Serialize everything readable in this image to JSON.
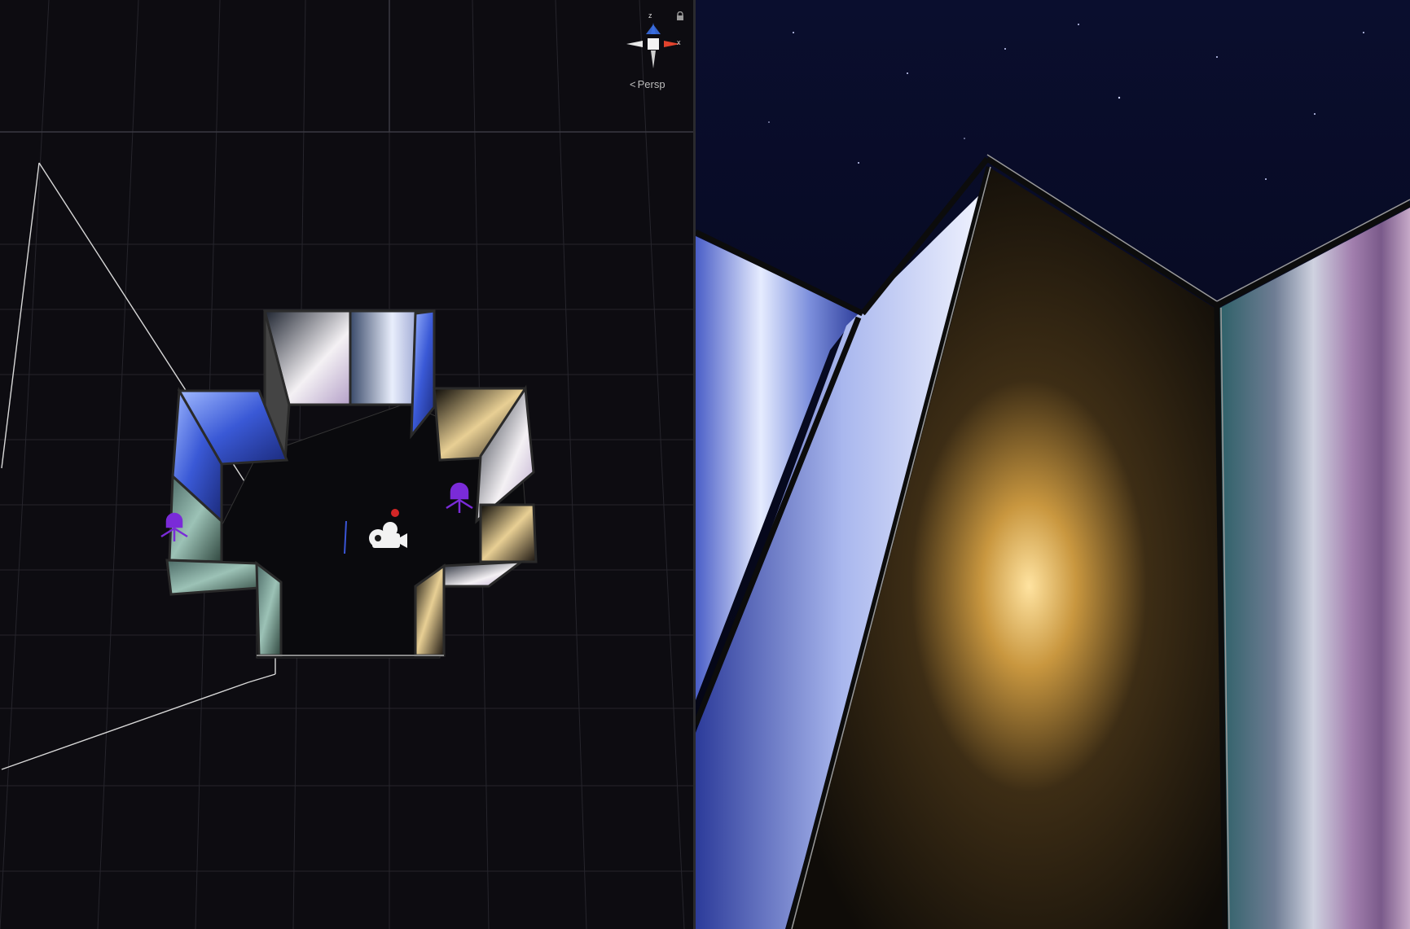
{
  "scene_view": {
    "gizmo": {
      "axis_z": "z",
      "axis_x": "x",
      "projection_label": "Persp"
    },
    "icons": [
      "lock-icon",
      "camera-icon",
      "light-probe-icon",
      "axis-gizmo-icon"
    ]
  },
  "game_view": {
    "description_free": true
  },
  "colors": {
    "grid": "#2b2a32",
    "axis_x": "#e2432d",
    "axis_y": "#ffffff",
    "axis_z": "#3a6de0",
    "probe": "#7a2bd8",
    "sky": "#050722"
  }
}
